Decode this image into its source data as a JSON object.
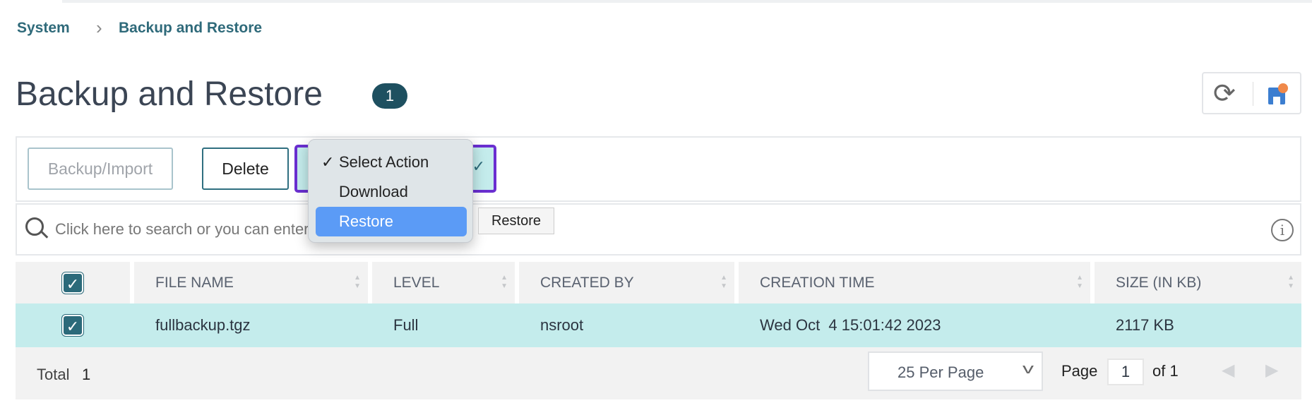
{
  "breadcrumb": {
    "items": [
      "System",
      "Backup and Restore"
    ]
  },
  "header": {
    "title": "Backup and Restore",
    "count": "1"
  },
  "toolbar": {
    "backup_label": "Backup/Import",
    "delete_label": "Delete",
    "select_action": {
      "options": [
        "Select Action",
        "Download",
        "Restore"
      ],
      "selected": "Select Action",
      "highlighted": "Restore"
    },
    "tooltip": "Restore"
  },
  "search": {
    "placeholder": "Click here to search or you can enter Key : Value format"
  },
  "table": {
    "columns": [
      "FILE NAME",
      "LEVEL",
      "CREATED BY",
      "CREATION TIME",
      "SIZE (IN KB)"
    ],
    "rows": [
      {
        "checked": true,
        "file_name": "fullbackup.tgz",
        "level": "Full",
        "created_by": "nsroot",
        "creation_time": "Wed Oct  4 15:01:42 2023",
        "size": "2117 KB"
      }
    ]
  },
  "footer": {
    "total_label": "Total",
    "total": "1",
    "per_page": "25 Per Page",
    "page_label": "Page",
    "page": "1",
    "of_label": "of 1"
  },
  "colors": {
    "accent": "#2c6a7a",
    "row_selected": "#c4ecec",
    "menu_highlight": "#5b9bf6",
    "focus": "#6a2fd0"
  }
}
